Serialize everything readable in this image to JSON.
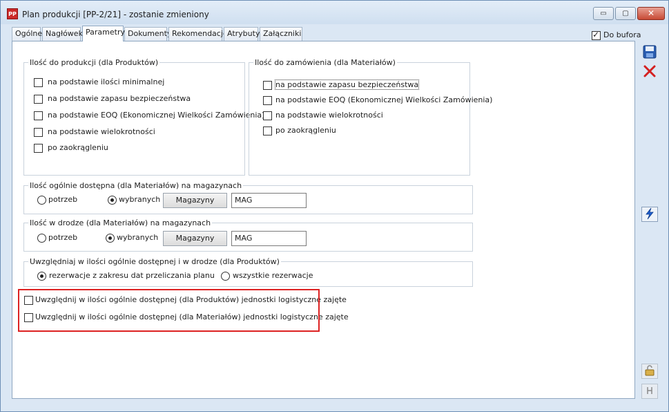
{
  "window": {
    "title": "Plan produkcji [PP-2/21] - zostanie zmieniony",
    "app_icon_text": "PP",
    "minimize_glyph": "▭",
    "maximize_glyph": "▢",
    "close_glyph": "✕"
  },
  "tabs": [
    {
      "label": "Ogólne"
    },
    {
      "label": "Nagłówek"
    },
    {
      "label": "Parametry"
    },
    {
      "label": "Dokumenty"
    },
    {
      "label": "Rekomendacje"
    },
    {
      "label": "Atrybuty"
    },
    {
      "label": "Załączniki"
    }
  ],
  "active_tab": "Parametry",
  "do_bufora": {
    "label": "Do bufora",
    "checked": true
  },
  "produkcja": {
    "title": "Ilość do produkcji (dla Produktów)",
    "options": [
      {
        "label": "na podstawie ilości minimalnej",
        "checked": false
      },
      {
        "label": "na podstawie zapasu bezpieczeństwa",
        "checked": false
      },
      {
        "label": "na podstawie EOQ (Ekonomicznej Wielkości Zamówienia)",
        "checked": false
      },
      {
        "label": "na podstawie wielokrotności",
        "checked": false
      },
      {
        "label": "po zaokrągleniu",
        "checked": false
      }
    ]
  },
  "zamowienie": {
    "title": "Ilość do zamówienia (dla Materiałów)",
    "options": [
      {
        "label": "na podstawie zapasu bezpieczeństwa",
        "checked": false
      },
      {
        "label": "na podstawie EOQ (Ekonomicznej Wielkości Zamówienia)",
        "checked": false
      },
      {
        "label": "na podstawie wielokrotności",
        "checked": false
      },
      {
        "label": "po zaokrągleniu",
        "checked": false
      }
    ]
  },
  "dostepna": {
    "title": "Ilość ogólnie dostępna (dla Materiałów) na magazynach",
    "radio_potrzeb": "potrzeb",
    "radio_wybranych": "wybranych",
    "selected": "wybranych",
    "button": "Magazyny",
    "value": "MAG"
  },
  "w_drodze": {
    "title": "Ilość w drodze (dla Materiałów) na magazynach",
    "radio_potrzeb": "potrzeb",
    "radio_wybranych": "wybranych",
    "selected": "wybranych",
    "button": "Magazyny",
    "value": "MAG"
  },
  "rezerwacje": {
    "title": "Uwzględniaj w ilości ogólnie dostępnej i w drodze (dla Produktów)",
    "option_zakres": "rezerwacje z zakresu dat przeliczania planu",
    "option_wszystkie": "wszystkie rezerwacje",
    "selected": "zakres"
  },
  "logistyczne": [
    {
      "label": "Uwzględnij w ilości ogólnie dostępnej (dla Produktów) jednostki logistyczne zajęte",
      "checked": false
    },
    {
      "label": "Uwzględnij w ilości ogólnie dostępnej (dla Materiałów) jednostki logistyczne zajęte",
      "checked": false
    }
  ],
  "colors": {
    "highlight_box": "#dd2222",
    "save_icon": "#2a5db0",
    "delete_icon": "#d42020",
    "lightning_icon": "#1f5fcf"
  }
}
